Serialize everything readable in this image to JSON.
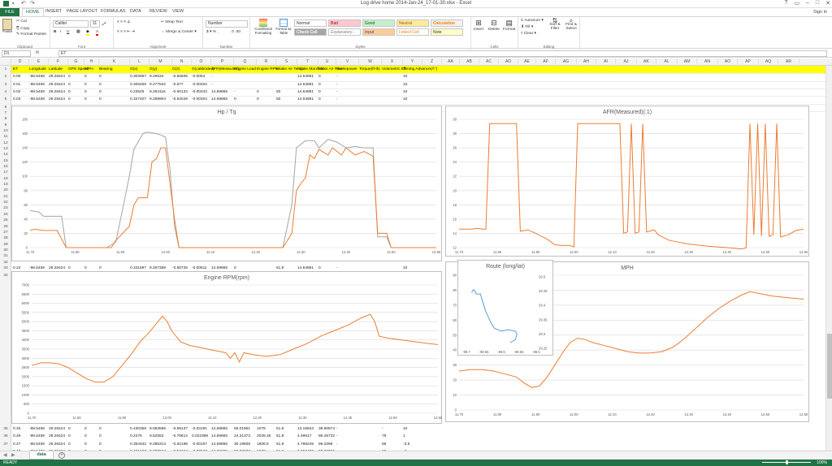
{
  "window": {
    "title": "Log drive home 2014-Jan-24_17-01-30.xlsx - Excel",
    "signin": "Sign in"
  },
  "tabs": [
    "FILE",
    "HOME",
    "INSERT",
    "PAGE LAYOUT",
    "FORMULAS",
    "DATA",
    "REVIEW",
    "VIEW"
  ],
  "ribbon": {
    "clipboard": {
      "paste": "Paste",
      "cut": "Cut",
      "copy": "Copy",
      "format_painter": "Format Painter",
      "label": "Clipboard"
    },
    "font": {
      "name": "Calibri",
      "size": "11",
      "label": "Font"
    },
    "alignment": {
      "wrap": "Wrap Text",
      "merge": "Merge & Center",
      "label": "Alignment"
    },
    "number": {
      "format": "Number",
      "label": "Number"
    },
    "styles": {
      "conditional": "Conditional Formatting",
      "format_table": "Format as Table",
      "normal": "Normal",
      "bad": "Bad",
      "good": "Good",
      "neutral": "Neutral",
      "calculation": "Calculation",
      "check_cell": "Check Cell",
      "explanatory": "Explanatory...",
      "input": "Input",
      "linked_cell": "Linked Cell",
      "note": "Note",
      "label": "Styles"
    },
    "cells": {
      "insert": "Insert",
      "delete": "Delete",
      "format": "Format",
      "label": "Cells"
    },
    "editing": {
      "autosum": "AutoSum",
      "fill": "Fill",
      "clear": "Clear",
      "sort": "Sort & Filter",
      "find": "Find & Select",
      "label": "Editing"
    }
  },
  "formula_bar": {
    "namebox": "D1",
    "fx": "fx",
    "content": "ET"
  },
  "columns": [
    "D",
    "E",
    "F",
    "G",
    "H",
    "K",
    "L",
    "M",
    "N",
    "O",
    "P",
    "Q",
    "R",
    "S",
    "T",
    "U",
    "V",
    "W",
    "X",
    "Y",
    "Z",
    "AA",
    "AB",
    "AC",
    "AD",
    "AE",
    "AF",
    "AG",
    "AH",
    "AI",
    "AJ",
    "AK",
    "AL",
    "AM",
    "AN",
    "AO",
    "AP",
    "AQ",
    "AR"
  ],
  "header_row": [
    "ET",
    "Longitude",
    "Latitude",
    "GPS Speed",
    "MPH",
    "Bearing",
    "G(x)",
    "G(y)",
    "G(z)",
    "G(calibrated)",
    "AFR(Measured)",
    "Engine Load",
    "Engine RPM",
    "Intake Air Temp",
    "Intake Manifold",
    "Mass Air Flow",
    "Horsepower",
    "Torque(ft-lb)",
    "Volumetric Eff",
    "Timing Advance(Â°)"
  ],
  "top_rows": [
    {
      "n": "2",
      "cells": [
        "0.00",
        "-98.5459",
        "29.28424",
        "0",
        "0",
        "0",
        "0.302867",
        "9.26534",
        "-0.55605",
        "-0.0054",
        "-",
        "",
        "",
        "",
        "14.64881",
        "0",
        "-",
        "",
        "",
        "10"
      ]
    },
    {
      "n": "3",
      "cells": [
        "0.01",
        "-98.5459",
        "29.28424",
        "0",
        "0",
        "0",
        "0.306458",
        "9.277532",
        "-0.577",
        "-0.00404",
        "-",
        "",
        "",
        "",
        "14.64881",
        "0",
        "-",
        "",
        "",
        "10"
      ]
    },
    {
      "n": "4",
      "cells": [
        "0.02",
        "-98.5459",
        "29.28424",
        "0",
        "0",
        "0",
        "0.23525",
        "9.284116",
        "-0.60134",
        "-0.00343",
        "14.69865",
        "-",
        "0",
        "50",
        "14.64881",
        "0",
        "-",
        "",
        "",
        "10"
      ]
    },
    {
      "n": "5",
      "cells": [
        "0.03",
        "-98.5459",
        "29.28424",
        "0",
        "0",
        "0",
        "0.327407",
        "9.288904",
        "-0.54049",
        "-0.00304",
        "14.69865",
        "0",
        "0",
        "50",
        "14.64881",
        "0",
        "-",
        "",
        "",
        "10"
      ]
    }
  ],
  "mid_row": {
    "n": "33",
    "cells": [
      "0.24",
      "-98.5459",
      "29.28424",
      "0",
      "0",
      "0",
      "0.331597",
      "9.267358",
      "-0.55725",
      "-0.00511",
      "14.69865",
      "0",
      "",
      "51.8",
      "14.64881",
      "0",
      "-",
      "",
      "",
      "10"
    ]
  },
  "bottom_rows": [
    {
      "n": "35",
      "cells": [
        "0.45",
        "-98.5459",
        "29.28424",
        "0",
        "0",
        "0",
        "0.430358",
        "9.083596",
        "-0.59137",
        "-0.02291",
        "14.69865",
        "65.01961",
        "1079",
        "51.8",
        "13.15843",
        "38.90574",
        "-",
        "",
        "-",
        "10"
      ]
    },
    {
      "n": "36",
      "cells": [
        "0.46",
        "-98.5459",
        "29.28424",
        "0",
        "0",
        "0",
        "0.2476",
        "9.52553",
        "-0.78614",
        "0.022398",
        "14.69865",
        "24.31373",
        "2028.25",
        "51.8",
        "4.49617",
        "86.49732",
        "-",
        "",
        "75",
        "1"
      ]
    },
    {
      "n": "37",
      "cells": [
        "0.47",
        "-98.5459",
        "29.28424",
        "0",
        "0",
        "0",
        "0.354342",
        "9.285313",
        "-0.62189",
        "-0.00157",
        "14.69865",
        "30.19608",
        "1808.5",
        "51.8",
        "4.786245",
        "96.3369",
        "-",
        "",
        "68",
        "-3.5"
      ]
    },
    {
      "n": "38",
      "cells": [
        "0.48",
        "-98.5459",
        "29.28424",
        "0",
        "0",
        "0",
        "0.401627",
        "9.280524",
        "-0.52194",
        "-0.00547",
        "14.69865",
        "33.33333",
        "1629",
        "51.8",
        "5.656472",
        "97.86096",
        "-",
        "",
        "68",
        "-3"
      ]
    }
  ],
  "sheet_tab": "data",
  "status": {
    "ready": "READY",
    "zoom": "100%"
  },
  "charts": {
    "hp": {
      "title": "Hp / Tq",
      "yticks": [
        "0",
        "20",
        "40",
        "60",
        "80",
        "100",
        "120",
        "140",
        "160",
        "180"
      ],
      "xticks": [
        "11.70",
        "11.80",
        "11.90",
        "12.00",
        "12.10",
        "12.20",
        "12.30",
        "12.40",
        "12.50",
        "12.60"
      ]
    },
    "afr": {
      "title": "AFR(Measured)(:1)",
      "yticks": [
        "12",
        "14",
        "16",
        "18",
        "20",
        "22",
        "24",
        "26",
        "28",
        "30"
      ],
      "xticks": [
        "11.70",
        "11.80",
        "11.90",
        "12.00",
        "12.10",
        "12.20",
        "12.30",
        "12.40",
        "12.50",
        "12.60"
      ]
    },
    "rpm": {
      "title": "Engine RPM(rpm)",
      "yticks": [
        "0",
        "500",
        "1000",
        "1500",
        "2000",
        "2500",
        "3000",
        "3500",
        "4000",
        "4500",
        "5000",
        "5500",
        "6000",
        "6500",
        "7000"
      ],
      "xticks": [
        "11.70",
        "11.80",
        "11.90",
        "12.00",
        "12.10",
        "12.20",
        "12.30",
        "12.40",
        "12.50",
        "12.60"
      ]
    },
    "mph": {
      "title": "MPH",
      "yticks": [
        "0",
        "10",
        "20",
        "30",
        "40",
        "50",
        "60",
        "70",
        "80",
        "90"
      ],
      "xticks": [
        "11.70",
        "11.80",
        "11.90",
        "12.00",
        "12.10",
        "12.20",
        "12.30",
        "12.40",
        "12.50",
        "12.60"
      ]
    },
    "route": {
      "title": "Route (long/lat)",
      "yticks": [
        "29.5",
        "29.45",
        "29.4",
        "29.35",
        "29.3",
        "29.25"
      ],
      "xticks": [
        "-98.7",
        "-98.65",
        "-98.6",
        "-98.55",
        "-98.5"
      ]
    }
  },
  "colors": {
    "orange": "#ED7D31",
    "gray": "#A5A5A5",
    "blue": "#5B9BD5",
    "excel_green": "#217346",
    "header_yellow": "#FFFF00"
  }
}
